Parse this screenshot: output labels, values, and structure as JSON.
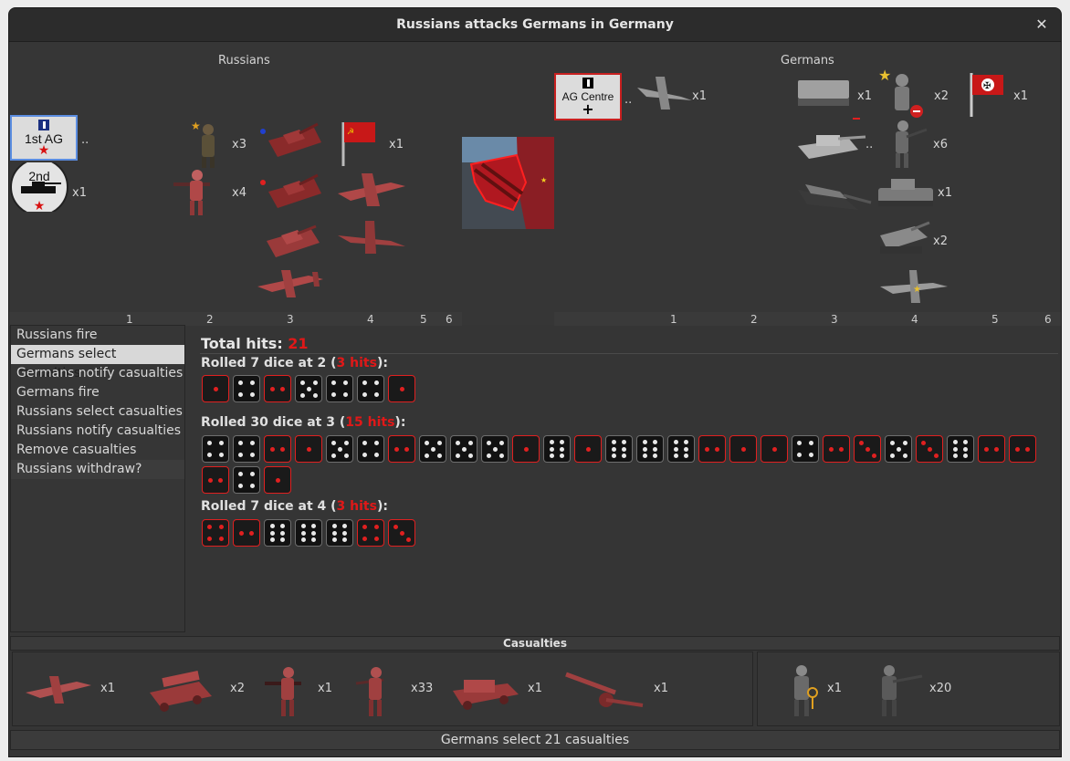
{
  "window": {
    "title": "Russians attacks Germans in Germany"
  },
  "board": {
    "attacker_label": "Russians",
    "defender_label": "Germans",
    "attacker_columns": [
      "1",
      "2",
      "3",
      "4",
      "5",
      "6"
    ],
    "defender_columns": [
      "1",
      "2",
      "3",
      "4",
      "5",
      "6"
    ],
    "russian_units": [
      {
        "name": "1st AG HQ",
        "count": ".."
      },
      {
        "name": "2nd Tank Army",
        "count": "x1"
      },
      {
        "name": "officer",
        "count": "x3"
      },
      {
        "name": "infantry",
        "count": "x4"
      },
      {
        "name": "soviet flag",
        "count": "x1"
      }
    ],
    "german_units": [
      {
        "name": "AG Centre HQ",
        "count": ".."
      },
      {
        "name": "stuka",
        "count": "x1"
      },
      {
        "name": "halftrack",
        "count": "x1"
      },
      {
        "name": "general",
        "count": "x2"
      },
      {
        "name": "german flag",
        "count": "x1"
      },
      {
        "name": "tiger tank",
        "count": ".."
      },
      {
        "name": "infantry",
        "count": "x6"
      },
      {
        "name": "light tank",
        "count": "x1"
      },
      {
        "name": "heavy tank",
        "count": "x2"
      }
    ]
  },
  "steps": [
    {
      "label": "Russians fire",
      "active": false
    },
    {
      "label": "Germans select casualties",
      "active": true
    },
    {
      "label": "Germans notify casualties",
      "active": false
    },
    {
      "label": "Germans fire",
      "active": false
    },
    {
      "label": "Russians select casualties",
      "active": false
    },
    {
      "label": "Russians notify casualties",
      "active": false
    },
    {
      "label": "Remove casualties",
      "active": false
    },
    {
      "label": "Russians withdraw?",
      "active": false
    }
  ],
  "results": {
    "total_label": "Total hits: ",
    "total_hits": "21",
    "rolls": [
      {
        "prefix": "Rolled 7 dice at 2 (",
        "hits": "3 hits",
        "suffix": "):",
        "dice": [
          1,
          4,
          2,
          5,
          4,
          4,
          1
        ]
      },
      {
        "prefix": "Rolled 30 dice at 3 (",
        "hits": "15 hits",
        "suffix": "):",
        "dice": [
          4,
          4,
          2,
          1,
          5,
          4,
          2,
          5,
          5,
          5,
          1,
          6,
          1,
          6,
          6,
          6,
          2,
          1,
          1,
          4,
          2,
          3,
          5,
          3,
          6,
          2,
          2,
          2,
          4,
          1
        ]
      },
      {
        "prefix": "Rolled 7 dice at 4 (",
        "hits": "3 hits",
        "suffix": "):",
        "dice": [
          4,
          2,
          6,
          6,
          6,
          4,
          3
        ]
      }
    ],
    "hit_threshold": [
      2,
      3,
      4
    ]
  },
  "casualties": {
    "title": "Casualties",
    "russian": [
      {
        "name": "fighter plane",
        "count": "x1"
      },
      {
        "name": "katyusha truck",
        "count": "x2"
      },
      {
        "name": "machine gunner",
        "count": "x1"
      },
      {
        "name": "infantry",
        "count": "x33"
      },
      {
        "name": "armored truck",
        "count": "x1"
      },
      {
        "name": "artillery",
        "count": "x1"
      }
    ],
    "german": [
      {
        "name": "officer",
        "count": "x1"
      },
      {
        "name": "infantry",
        "count": "x20"
      }
    ]
  },
  "status": "Germans select 21 casualties",
  "colors": {
    "hit": "#e01818",
    "russian_unit": "#b04848",
    "german_unit": "#9a9a9a"
  }
}
